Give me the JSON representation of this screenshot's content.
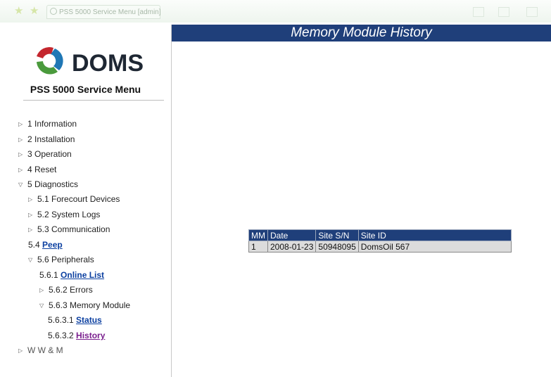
{
  "browser": {
    "tab_title": "PSS 5000 Service Menu [admin]"
  },
  "sidebar": {
    "logo_text": "DOMS",
    "logo_colors": [
      "#c4262e",
      "#1f77b5",
      "#4a9a3c"
    ],
    "menu_title": "PSS 5000 Service Menu",
    "items": [
      {
        "label": "1 Information",
        "state": "collapsed"
      },
      {
        "label": "2 Installation",
        "state": "collapsed"
      },
      {
        "label": "3 Operation",
        "state": "collapsed"
      },
      {
        "label": "4 Reset",
        "state": "collapsed"
      },
      {
        "label": "5 Diagnostics",
        "state": "expanded"
      },
      {
        "label": "5.1 Forecourt Devices",
        "state": "collapsed"
      },
      {
        "label": "5.2 System Logs",
        "state": "collapsed"
      },
      {
        "label": "5.3 Communication",
        "state": "collapsed"
      },
      {
        "prefix": "5.4 ",
        "link": "Peep"
      },
      {
        "label": "5.6 Peripherals",
        "state": "expanded"
      },
      {
        "prefix": "5.6.1 ",
        "link": "Online List"
      },
      {
        "label": "5.6.2 Errors",
        "state": "collapsed"
      },
      {
        "label": "5.6.3 Memory Module",
        "state": "expanded"
      },
      {
        "prefix": "5.6.3.1 ",
        "link": "Status"
      },
      {
        "prefix": "5.6.3.2 ",
        "link": "History"
      },
      {
        "label": "W W & M",
        "state": "collapsed"
      }
    ]
  },
  "main": {
    "title": "Memory Module History",
    "table": {
      "columns": [
        "MM",
        "Date",
        "Site S/N",
        "Site ID"
      ],
      "rows": [
        [
          "1",
          "2008-01-23",
          "50948095",
          "DomsOil 567"
        ]
      ]
    }
  },
  "colors": {
    "header_bg": "#1f3f7a",
    "link": "#0b3fa0",
    "link_visited": "#7a1f8e"
  }
}
